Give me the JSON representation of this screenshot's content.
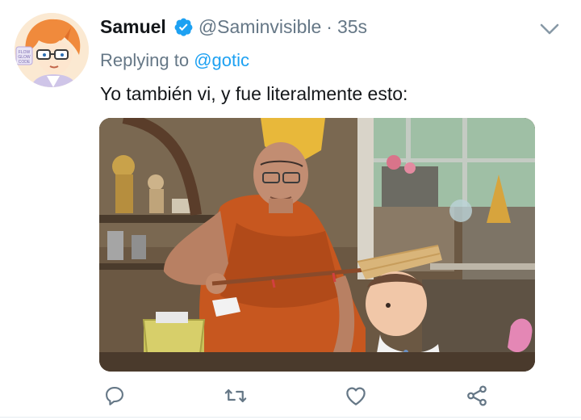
{
  "tweet": {
    "author_name": "Samuel",
    "handle": "@Saminvisible",
    "separator": "·",
    "time": "35s",
    "replying_prefix": "Replying to",
    "replying_to": "@gotic",
    "text": "Yo también vi, y fue literalmente esto:",
    "verified": true,
    "avatar_text": "FLOW GLOW CODE"
  },
  "icons": {
    "reply": "reply-bubble-icon",
    "retweet": "retweet-icon",
    "like": "heart-icon",
    "share": "share-icon",
    "more": "chevron-down-icon",
    "verified": "verified-badge-icon"
  },
  "colors": {
    "accent": "#1da1f2",
    "secondary_text": "#657786",
    "primary_text": "#14171a"
  }
}
